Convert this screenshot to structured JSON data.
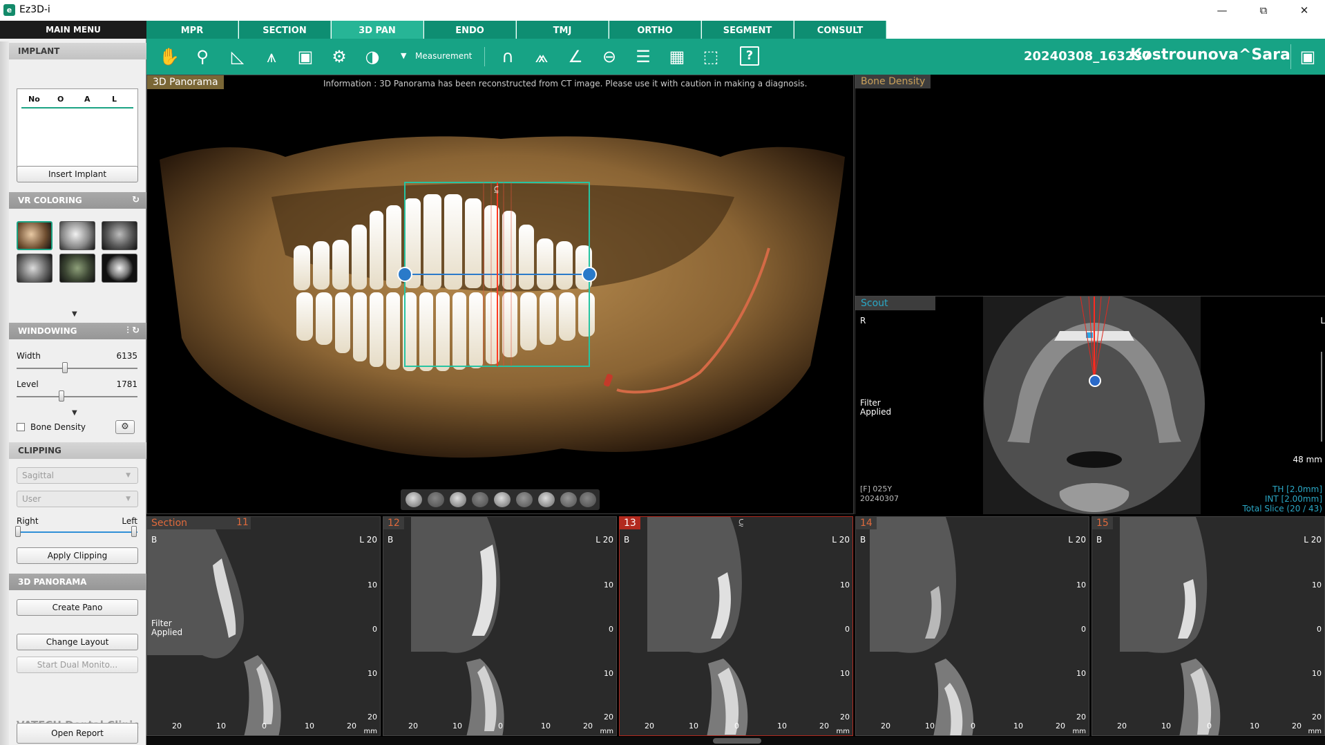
{
  "window": {
    "title": "Ez3D-i",
    "app_icon": "app-logo-icon",
    "controls": [
      "minimize-icon",
      "restore-icon",
      "close-icon"
    ]
  },
  "sidebar": {
    "main_menu": "MAIN MENU",
    "implant": {
      "header": "IMPLANT",
      "columns": [
        "No",
        "O",
        "A",
        "L"
      ],
      "insert_button": "Insert Implant"
    },
    "vr_coloring": {
      "header": "VR COLORING",
      "presets": [
        "color-skin-preset",
        "skull-xray-preset",
        "soft-tissue-preset",
        "face-gray-preset",
        "green-tissue-preset",
        "skull-dark-preset"
      ],
      "selected": 0
    },
    "windowing": {
      "header": "WINDOWING",
      "width_label": "Width",
      "width_value": "6135",
      "width_fraction": 0.4,
      "level_label": "Level",
      "level_value": "1781",
      "level_fraction": 0.37,
      "bone_density_label": "Bone Density",
      "bone_density_checked": false
    },
    "clipping": {
      "header": "CLIPPING",
      "plane": "Sagittal",
      "mode": "User",
      "right_label": "Right",
      "left_label": "Left",
      "apply_button": "Apply Clipping"
    },
    "panorama": {
      "header": "3D PANORAMA",
      "create_button": "Create Pano",
      "layout_button": "Change Layout",
      "dual_button": "Start Dual Monito...",
      "clinic": "VATECH Dental Clinic",
      "report_button": "Open Report"
    }
  },
  "tabs": [
    {
      "label": "MPR",
      "active": false
    },
    {
      "label": "SECTION",
      "active": false
    },
    {
      "label": "3D PAN",
      "active": true
    },
    {
      "label": "ENDO",
      "active": false
    },
    {
      "label": "TMJ",
      "active": false
    },
    {
      "label": "ORTHO",
      "active": false
    },
    {
      "label": "SEGMENT",
      "active": false
    },
    {
      "label": "CONSULT",
      "active": false
    }
  ],
  "toolbar": {
    "tools": [
      "pan-hand-icon",
      "zoom-icon",
      "ruler-icon",
      "polyline-icon",
      "camera-icon",
      "settings-face-icon",
      "image-export-icon"
    ],
    "measurement_label": "Measurement",
    "right_tools": [
      "arch-icon",
      "arch-nerve-icon",
      "angle-icon",
      "circle-minus-icon",
      "layers-icon",
      "grid-icon",
      "cube-icon"
    ],
    "patient_date": "20240308_163237",
    "patient_name": "Kostrounova^Sara"
  },
  "views": {
    "pano": {
      "label": "3D Panorama",
      "info": "Information : 3D Panorama has been reconstructed from CT image. Please use it with caution in making a diagnosis."
    },
    "bone_density": {
      "label": "Bone Density"
    },
    "scout": {
      "label": "Scout",
      "left_mark": "R",
      "right_mark": "L",
      "filter": "Filter Applied",
      "patient": "[F] 025Y",
      "date": "20240307",
      "scale": "48 mm",
      "thickness": "TH [2.0mm]",
      "interval": "INT [2.00mm]",
      "slice": "Total Slice (20 / 43)"
    }
  },
  "sections": {
    "label": "Section",
    "filter": "Filter Applied",
    "panels": [
      {
        "num": "11",
        "active": false
      },
      {
        "num": "12",
        "active": false
      },
      {
        "num": "13",
        "active": true
      },
      {
        "num": "14",
        "active": false
      },
      {
        "num": "15",
        "active": false
      }
    ],
    "b_mark": "B",
    "l_mark": "L",
    "vticks": [
      "20",
      "10",
      "0",
      "10",
      "20"
    ],
    "hticks": [
      "20",
      "10",
      "0",
      "10",
      "20"
    ],
    "unit": "mm"
  }
}
